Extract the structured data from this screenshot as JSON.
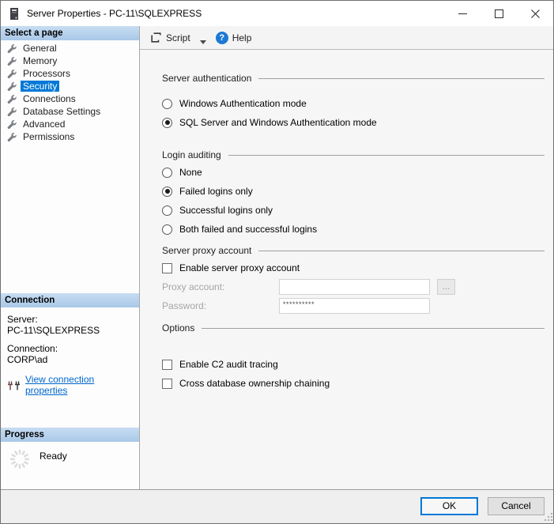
{
  "window": {
    "title": "Server Properties - PC-11\\SQLEXPRESS"
  },
  "toolbar": {
    "script_label": "Script",
    "help_label": "Help"
  },
  "icons": {
    "help_glyph": "?"
  },
  "sidebar": {
    "select_page": {
      "header": "Select a page",
      "items": [
        {
          "label": "General",
          "selected": false
        },
        {
          "label": "Memory",
          "selected": false
        },
        {
          "label": "Processors",
          "selected": false
        },
        {
          "label": "Security",
          "selected": true
        },
        {
          "label": "Connections",
          "selected": false
        },
        {
          "label": "Database Settings",
          "selected": false
        },
        {
          "label": "Advanced",
          "selected": false
        },
        {
          "label": "Permissions",
          "selected": false
        }
      ]
    },
    "connection_panel": {
      "header": "Connection",
      "server_label": "Server:",
      "server_value": "PC-11\\SQLEXPRESS",
      "connection_label": "Connection:",
      "connection_value": "CORP\\ad",
      "view_link": "View connection properties"
    },
    "progress_panel": {
      "header": "Progress",
      "status": "Ready"
    }
  },
  "main": {
    "sections": {
      "server_authentication": {
        "title": "Server authentication",
        "options": [
          {
            "label": "Windows Authentication mode",
            "selected": false
          },
          {
            "label": "SQL Server and Windows Authentication mode",
            "selected": true
          }
        ]
      },
      "login_auditing": {
        "title": "Login auditing",
        "options": [
          {
            "label": "None",
            "selected": false
          },
          {
            "label": "Failed logins only",
            "selected": true
          },
          {
            "label": "Successful logins only",
            "selected": false
          },
          {
            "label": "Both failed and successful logins",
            "selected": false
          }
        ]
      },
      "server_proxy": {
        "title": "Server proxy account",
        "enable_label": "Enable server proxy account",
        "enable_checked": false,
        "proxy_label": "Proxy account:",
        "proxy_value": "",
        "browse_label": "...",
        "password_label": "Password:",
        "password_value": "**********"
      },
      "options": {
        "title": "Options",
        "checkboxes": [
          {
            "label": "Enable C2 audit tracing",
            "checked": false
          },
          {
            "label": "Cross database ownership chaining",
            "checked": false
          }
        ]
      }
    }
  },
  "footer": {
    "ok_label": "OK",
    "cancel_label": "Cancel"
  },
  "colors": {
    "accent": "#0078d7",
    "link": "#0066cc",
    "sidebar_header_top": "#c7ddf2",
    "sidebar_header_bottom": "#a9c8e8",
    "selected_text": "#ffffff"
  }
}
